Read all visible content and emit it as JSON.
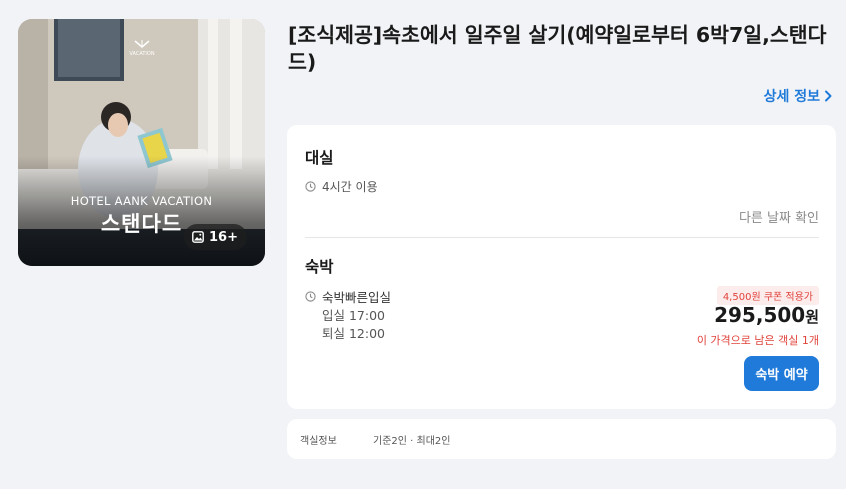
{
  "card": {
    "hotel_name": "HOTEL AANK VACATION",
    "room_overlay": "스탠다드",
    "photo_count": "16+",
    "logo_text": "VACATION"
  },
  "title": "[조식제공]속초에서 일주일 살기(예약일로부터 6박7일,스탠다드)",
  "detail_link": "상세 정보",
  "dayuse": {
    "title": "대실",
    "duration": "4시간 이용",
    "other_date": "다른 날짜 확인"
  },
  "stay": {
    "title": "숙박",
    "checkin_type": "숙박빠른입실",
    "checkin": "입실 17:00",
    "checkout": "퇴실 12:00",
    "coupon": "4,500원 쿠폰 적용가",
    "price": "295,500",
    "currency": "원",
    "rooms_left": "이 가격으로 남은 객실 1개",
    "book_label": "숙박 예약"
  },
  "room_info": {
    "label": "객실정보",
    "value": "기준2인 · 최대2인"
  },
  "colors": {
    "accent": "#1f7ad9",
    "alert": "#e0433b",
    "background": "#f2f3f7"
  }
}
